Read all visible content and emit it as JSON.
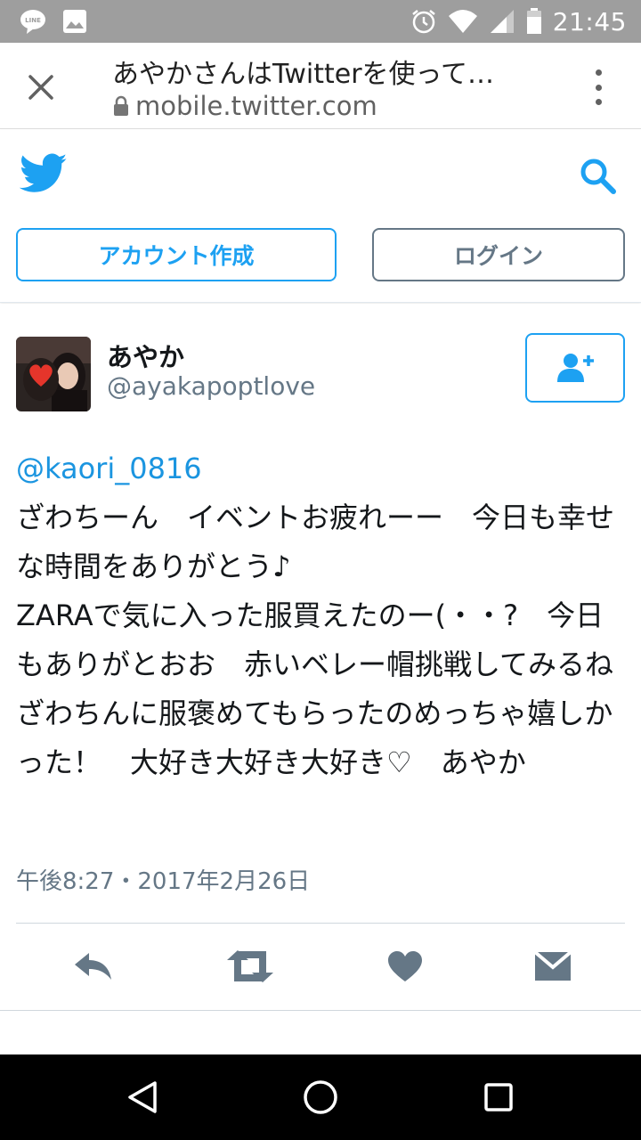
{
  "status_bar": {
    "time": "21:45",
    "notification_icons": [
      "line-icon",
      "gallery-icon"
    ],
    "system_icons": [
      "alarm-icon",
      "wifi-icon",
      "signal-icon",
      "battery-icon"
    ]
  },
  "custom_tab": {
    "title": "あやかさんはTwitterを使って…",
    "url": "mobile.twitter.com"
  },
  "twitter_header": {
    "signup_label": "アカウント作成",
    "login_label": "ログイン"
  },
  "tweet": {
    "display_name": "あやか",
    "handle": "@ayakapoptlove",
    "mention": "@kaori_0816",
    "body": "ざわちーん　イベントお疲れーー　今日も幸せな時間をありがとう♪\nZARAで気に入った服買えたのー(・・?　今日もありがとおお　赤いベレー帽挑戦してみるね　ざわちんに服褒めてもらったのめっちゃ嬉しかった！　大好き大好き大好き♡　あやか",
    "timestamp": "午後8:27・2017年2月26日"
  },
  "colors": {
    "twitter_blue": "#1da1f2",
    "link_blue": "#1b95e0",
    "secondary_gray": "#657786",
    "status_bar": "#9e9e9e",
    "nav_bar": "#000000"
  }
}
